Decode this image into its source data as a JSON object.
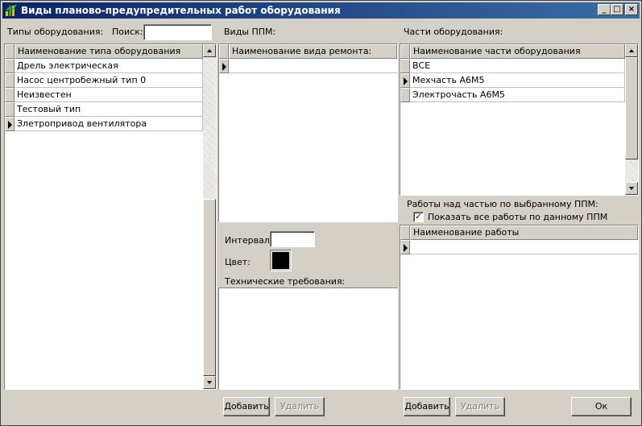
{
  "window": {
    "title": "Виды планово-предупредительных работ оборудования"
  },
  "titlebar_buttons": {
    "minimize": "_",
    "maximize": "□",
    "close": "×"
  },
  "equipment_types": {
    "label": "Типы оборудования:",
    "search_label": "Поиск:",
    "search_value": "",
    "column": "Наименование типа оборудования",
    "rows": [
      "Дрель электрическая",
      "Насос центробежный тип 0",
      "Неизвестен",
      "Тестовый тип",
      "Злетропривод вентилятора"
    ],
    "selected_index": 4
  },
  "ppm": {
    "label": "Виды ППМ:",
    "column": "Наименование вида ремонта:",
    "interval_label": "Интервал:",
    "interval_value": "",
    "color_label": "Цвет:",
    "color_value": "#000000",
    "tech_label": "Технические требования:",
    "tech_value": ""
  },
  "parts": {
    "label": "Части оборудования:",
    "column": "Наименование части оборудования",
    "rows": [
      "ВСЕ",
      "Мехчасть А6М5",
      "Электрочасть А6М5"
    ],
    "selected_index": 1
  },
  "works": {
    "label": "Работы над частью по выбранному ППМ:",
    "show_all_label": "Показать все работы по данному  ППМ",
    "show_all_checked": "✓",
    "column": "Наименование работы"
  },
  "buttons": {
    "add_ppm": "Добавить",
    "delete_ppm": "Удалить",
    "add_work": "Добавить",
    "delete_work": "Удалить",
    "ok": "Ок"
  }
}
